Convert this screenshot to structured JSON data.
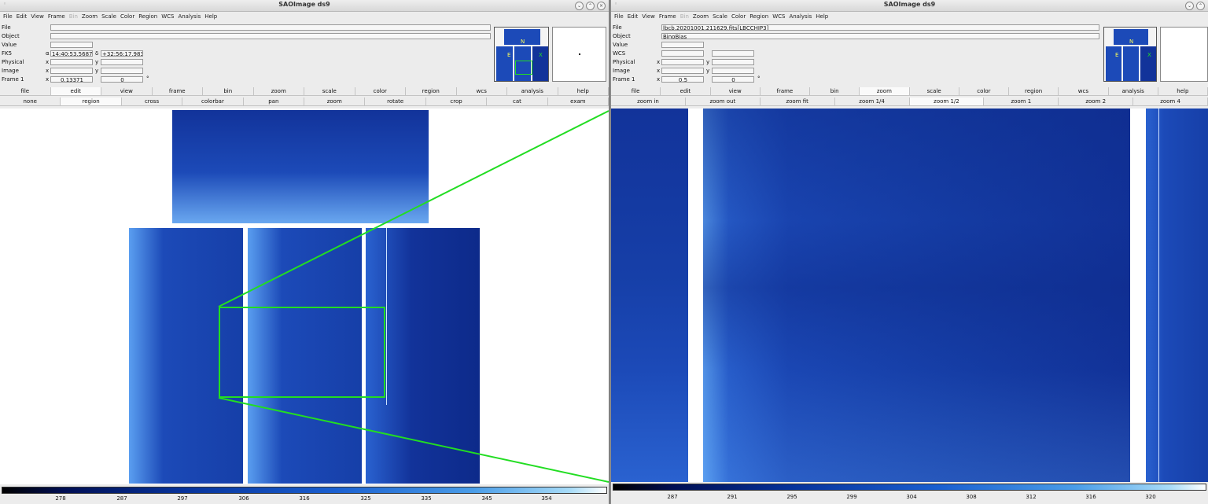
{
  "left": {
    "title": "SAOImage ds9",
    "menu": [
      "File",
      "Edit",
      "View",
      "Frame",
      "Bin",
      "Zoom",
      "Scale",
      "Color",
      "Region",
      "WCS",
      "Analysis",
      "Help"
    ],
    "labels": {
      "file": "File",
      "object": "Object",
      "value": "Value",
      "coord": "FK5",
      "physical": "Physical",
      "image": "Image",
      "frame": "Frame 1"
    },
    "sub": {
      "alpha": "α",
      "delta": "δ",
      "x": "x",
      "y": "y",
      "deg": "°"
    },
    "values": {
      "file": "",
      "object": "",
      "value": "",
      "ra": "14:40:53.5687",
      "dec": "+32:56:17.983",
      "phys_x": "",
      "phys_y": "",
      "img_x": "",
      "img_y": "",
      "zoom": "0.13371",
      "angle": "0"
    },
    "buttons": [
      "file",
      "edit",
      "view",
      "frame",
      "bin",
      "zoom",
      "scale",
      "color",
      "region",
      "wcs",
      "analysis",
      "help"
    ],
    "active_button": "edit",
    "subbuttons": [
      "none",
      "region",
      "cross",
      "colorbar",
      "pan",
      "zoom",
      "rotate",
      "crop",
      "cat",
      "exam"
    ],
    "active_subbutton": "region",
    "colorbar_ticks": [
      "278",
      "287",
      "297",
      "306",
      "316",
      "325",
      "335",
      "345",
      "354"
    ]
  },
  "right": {
    "title": "SAOImage ds9",
    "menu": [
      "File",
      "Edit",
      "View",
      "Frame",
      "Bin",
      "Zoom",
      "Scale",
      "Color",
      "Region",
      "WCS",
      "Analysis",
      "Help"
    ],
    "labels": {
      "file": "File",
      "object": "Object",
      "value": "Value",
      "coord": "WCS",
      "physical": "Physical",
      "image": "Image",
      "frame": "Frame 1"
    },
    "sub": {
      "x": "x",
      "y": "y",
      "deg": "°"
    },
    "values": {
      "file": "lbcb.20201001.211629.fits[LBCCHIP3]",
      "object": "BinoBias",
      "value": "",
      "wcs_x": "",
      "wcs_y": "",
      "phys_x": "",
      "phys_y": "",
      "img_x": "",
      "img_y": "",
      "zoom": "0.5",
      "angle": "0"
    },
    "buttons": [
      "file",
      "edit",
      "view",
      "frame",
      "bin",
      "zoom",
      "scale",
      "color",
      "region",
      "wcs",
      "analysis",
      "help"
    ],
    "active_button": "zoom",
    "subbuttons": [
      "zoom in",
      "zoom out",
      "zoom fit",
      "zoom 1/4",
      "zoom 1/2",
      "zoom 1",
      "zoom 2",
      "zoom 4"
    ],
    "active_subbutton": "zoom 1/2",
    "colorbar_ticks": [
      "287",
      "291",
      "295",
      "299",
      "304",
      "308",
      "312",
      "316",
      "320"
    ]
  },
  "colors": {
    "region": "#22dd22",
    "ccd_dark": "#0d2a8a",
    "ccd_mid": "#1c4ab8",
    "ccd_light": "#5a9ef0",
    "compass": "#ffff55"
  }
}
